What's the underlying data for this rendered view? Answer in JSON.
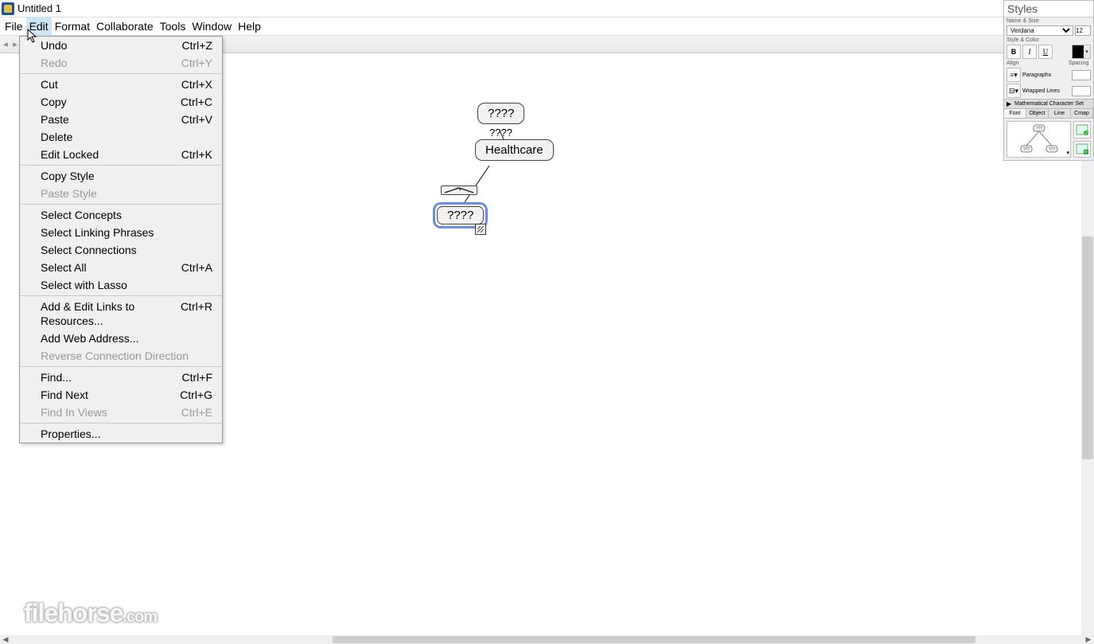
{
  "window": {
    "title": "Untitled 1"
  },
  "menubar": {
    "items": [
      "File",
      "Edit",
      "Format",
      "Collaborate",
      "Tools",
      "Window",
      "Help"
    ],
    "active_index": 1
  },
  "edit_menu": {
    "groups": [
      [
        {
          "label": "Undo",
          "shortcut": "Ctrl+Z",
          "disabled": false
        },
        {
          "label": "Redo",
          "shortcut": "Ctrl+Y",
          "disabled": true
        }
      ],
      [
        {
          "label": "Cut",
          "shortcut": "Ctrl+X",
          "disabled": false
        },
        {
          "label": "Copy",
          "shortcut": "Ctrl+C",
          "disabled": false
        },
        {
          "label": "Paste",
          "shortcut": "Ctrl+V",
          "disabled": false
        },
        {
          "label": "Delete",
          "shortcut": "",
          "disabled": false
        },
        {
          "label": "Edit Locked",
          "shortcut": "Ctrl+K",
          "disabled": false
        }
      ],
      [
        {
          "label": "Copy Style",
          "shortcut": "",
          "disabled": false
        },
        {
          "label": "Paste Style",
          "shortcut": "",
          "disabled": true
        }
      ],
      [
        {
          "label": "Select Concepts",
          "shortcut": "",
          "disabled": false
        },
        {
          "label": "Select Linking Phrases",
          "shortcut": "",
          "disabled": false
        },
        {
          "label": "Select Connections",
          "shortcut": "",
          "disabled": false
        },
        {
          "label": "Select All",
          "shortcut": "Ctrl+A",
          "disabled": false
        },
        {
          "label": "Select with Lasso",
          "shortcut": "",
          "disabled": false
        }
      ],
      [
        {
          "label": "Add & Edit Links to Resources...",
          "shortcut": "Ctrl+R",
          "disabled": false
        },
        {
          "label": "Add Web Address...",
          "shortcut": "",
          "disabled": false
        },
        {
          "label": "Reverse Connection Direction",
          "shortcut": "",
          "disabled": true
        }
      ],
      [
        {
          "label": "Find...",
          "shortcut": "Ctrl+F",
          "disabled": false
        },
        {
          "label": "Find Next",
          "shortcut": "Ctrl+G",
          "disabled": false
        },
        {
          "label": "Find In Views",
          "shortcut": "Ctrl+E",
          "disabled": true
        }
      ],
      [
        {
          "label": "Properties...",
          "shortcut": "",
          "disabled": false
        }
      ]
    ]
  },
  "canvas": {
    "node1_text": "????",
    "link_text": "????",
    "node2_text": "Healthcare",
    "node3_text": "????"
  },
  "styles_panel": {
    "title": "Styles",
    "section_name_size": "Name & Size",
    "font_name": "Verdana",
    "font_size": "12",
    "section_style_color": "Style & Color",
    "bold": "B",
    "italic": "I",
    "underline": "U",
    "align_label": "Align",
    "spacing_label": "Spacing",
    "paragraphs_label": "Paragraphs",
    "wrapped_label": "Wrapped Lines",
    "math_label": "Mathematical Character Set",
    "tabs": [
      "Font",
      "Object",
      "Line",
      "Cmap"
    ],
    "active_tab": 0
  },
  "watermark": {
    "text": "filehorse",
    "suffix": ".com"
  }
}
